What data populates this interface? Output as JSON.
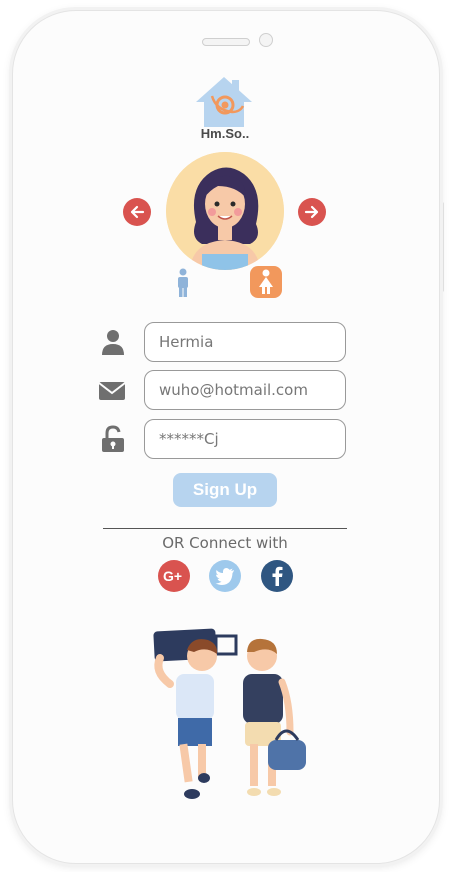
{
  "brand": {
    "name": "Hm.So.."
  },
  "profile": {
    "avatar_icon": "woman-avatar",
    "selected_gender": "female"
  },
  "form": {
    "name_value": "Hermia",
    "email_value": "wuho@hotmail.com",
    "password_value": "******Cj"
  },
  "actions": {
    "signup_label": "Sign Up"
  },
  "social": {
    "connect_label": "OR Connect with",
    "providers": [
      "google-plus",
      "twitter",
      "facebook"
    ]
  },
  "colors": {
    "accent_red": "#d9534f",
    "signup_bg": "#b7d4ef",
    "female_badge": "#f2985c",
    "male_icon": "#8fb3d9",
    "google": "#d9534f",
    "twitter": "#9ec9ec",
    "facebook": "#2f5681"
  }
}
